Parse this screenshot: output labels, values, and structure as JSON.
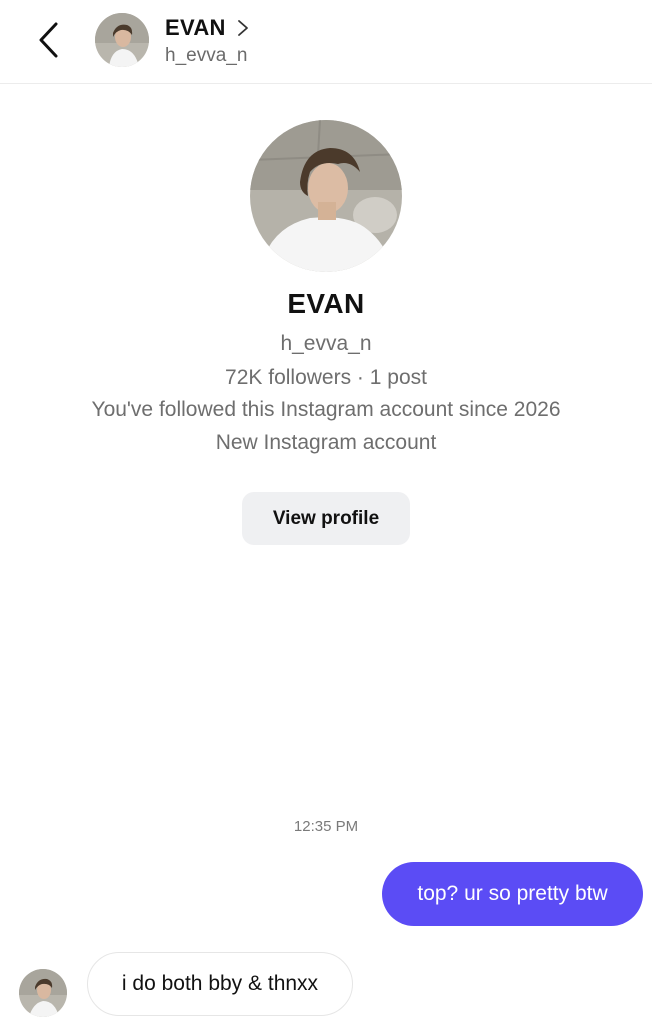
{
  "header": {
    "name": "EVAN",
    "username": "h_evva_n"
  },
  "profile": {
    "name": "EVAN",
    "username": "h_evva_n",
    "stats": "72K followers · 1 post",
    "follow_info": "You've followed this Instagram account since 2026",
    "account_note": "New Instagram account",
    "view_profile_label": "View profile"
  },
  "conversation": {
    "timestamp": "12:35 PM",
    "messages": [
      {
        "direction": "outgoing",
        "text": "top? ur so pretty btw"
      },
      {
        "direction": "incoming",
        "text": "i do both bby & thnxx"
      }
    ]
  },
  "icons": {
    "back": "chevron-left-icon",
    "header_chevron": "chevron-right-icon"
  },
  "colors": {
    "outgoing_bubble": "#5b4cf5",
    "incoming_bubble_border": "#e6e6e6",
    "view_profile_button": "#eff0f2",
    "secondary_text": "#6e6e6e"
  }
}
